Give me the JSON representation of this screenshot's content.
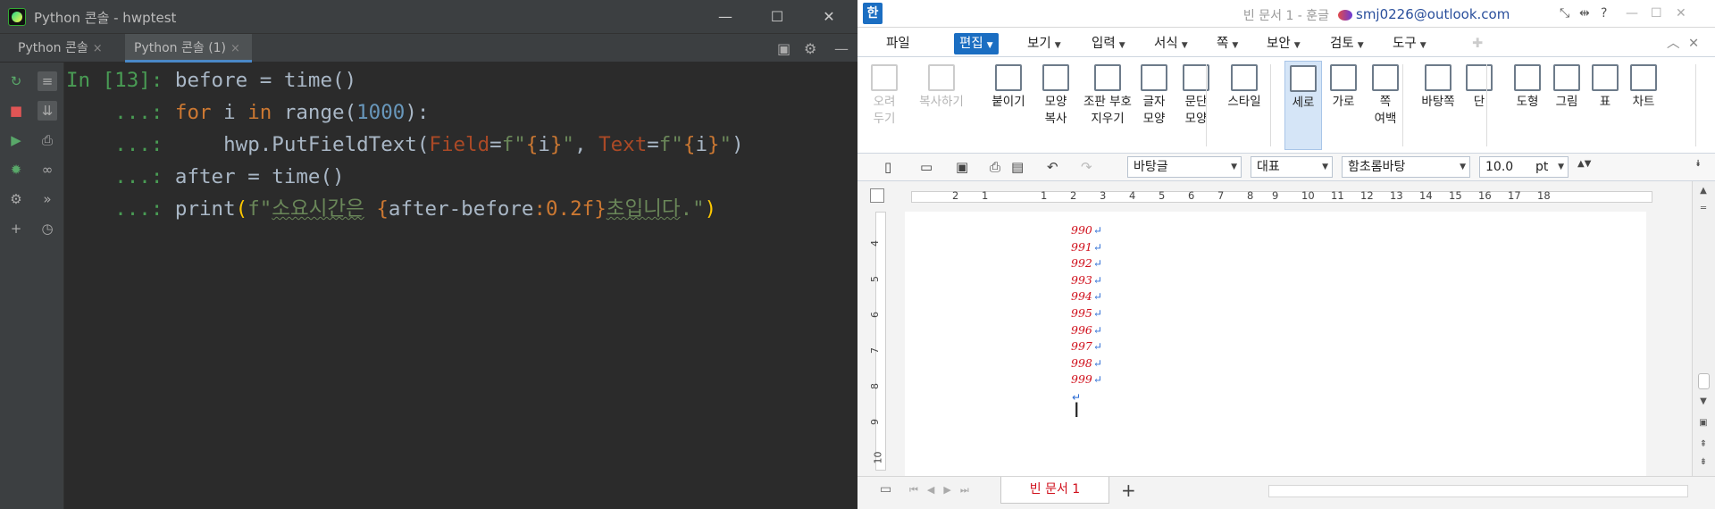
{
  "pycharm": {
    "title": "Python 콘솔 - hwptest",
    "window": {
      "minimize": "—",
      "maximize": "☐",
      "close": "✕"
    },
    "tabs": [
      {
        "label": "Python 콘솔",
        "close": "×"
      },
      {
        "label": "Python 콘솔 (1)",
        "close": "×"
      }
    ],
    "console": {
      "prompt_in": "In [13]:",
      "prompt_cont": "...:",
      "line1": "before = time()",
      "line2": {
        "kw_for": "for",
        "var": " i ",
        "kw_in": "in",
        "call": " range(",
        "num": "1000",
        "tail": "):"
      },
      "line3": {
        "pre": "    hwp.PutFieldText(",
        "p1": "Field",
        "eq1": "=",
        "s1a": "f\"",
        "b1a": "{",
        "s1v": "i",
        "b1b": "}",
        "s1c": "\"",
        ", ": ", ",
        "p2": "Text",
        "eq2": "=",
        "s2a": "f\"",
        "b2a": "{",
        "s2v": "i",
        "b2b": "}",
        "s2c": "\"",
        "close": ")"
      },
      "line4": "after = time()",
      "line5": {
        "pre": "print",
        "op": "(",
        "s1": "f\"",
        "ko1": "소요시간은",
        "sp": " ",
        "lb": "{",
        "expr": "after-before",
        "fmt": ":0.2f",
        "rb": "}",
        "ko2": "초입니다",
        "s2": ".\"",
        "cp": ")"
      }
    }
  },
  "hwp": {
    "logo": "한",
    "doc_title": "빈 문서 1 - 훈글",
    "user": "smj0226@outlook.com",
    "menus": [
      "파일",
      "편집",
      "보기",
      "입력",
      "서식",
      "쪽",
      "보안",
      "검토",
      "도구"
    ],
    "ribbon": [
      {
        "label": "오려\n두기",
        "icon": "scissors-icon"
      },
      {
        "label": "복사하기",
        "icon": "copy-icon"
      },
      {
        "label": "붙이기",
        "icon": "paste-icon"
      },
      {
        "label": "모양\n복사",
        "icon": "format-painter-icon"
      },
      {
        "label": "조판 부호\n지우기",
        "icon": "clear-codes-icon"
      },
      {
        "label": "글자\n모양",
        "icon": "char-shape-icon"
      },
      {
        "label": "문단\n모양",
        "icon": "para-shape-icon"
      },
      {
        "label": "스타일",
        "icon": "style-icon"
      },
      {
        "label": "세로",
        "icon": "portrait-icon"
      },
      {
        "label": "가로",
        "icon": "landscape-icon"
      },
      {
        "label": "쪽\n여백",
        "icon": "margin-icon"
      },
      {
        "label": "바탕쪽",
        "icon": "master-page-icon"
      },
      {
        "label": "단",
        "icon": "columns-icon"
      },
      {
        "label": "도형",
        "icon": "shape-icon"
      },
      {
        "label": "그림",
        "icon": "picture-icon"
      },
      {
        "label": "표",
        "icon": "table-icon"
      },
      {
        "label": "차트",
        "icon": "chart-icon"
      }
    ],
    "format": {
      "style": "바탕글",
      "lang": "대표",
      "font": "함초롬바탕",
      "size": "10.0",
      "unit": "pt"
    },
    "ruler_h": [
      "2",
      "1",
      "1",
      "2",
      "3",
      "4",
      "5",
      "6",
      "7",
      "8",
      "9",
      "10",
      "11",
      "12",
      "13",
      "14",
      "15",
      "16",
      "17",
      "18"
    ],
    "ruler_v": [
      "4",
      "5",
      "6",
      "7",
      "8",
      "9",
      "10"
    ],
    "lines": [
      "990",
      "991",
      "992",
      "993",
      "994",
      "995",
      "996",
      "997",
      "998",
      "999"
    ],
    "return_mark": "↵",
    "doc_tab": "빈 문서 1",
    "add_tab": "+"
  }
}
